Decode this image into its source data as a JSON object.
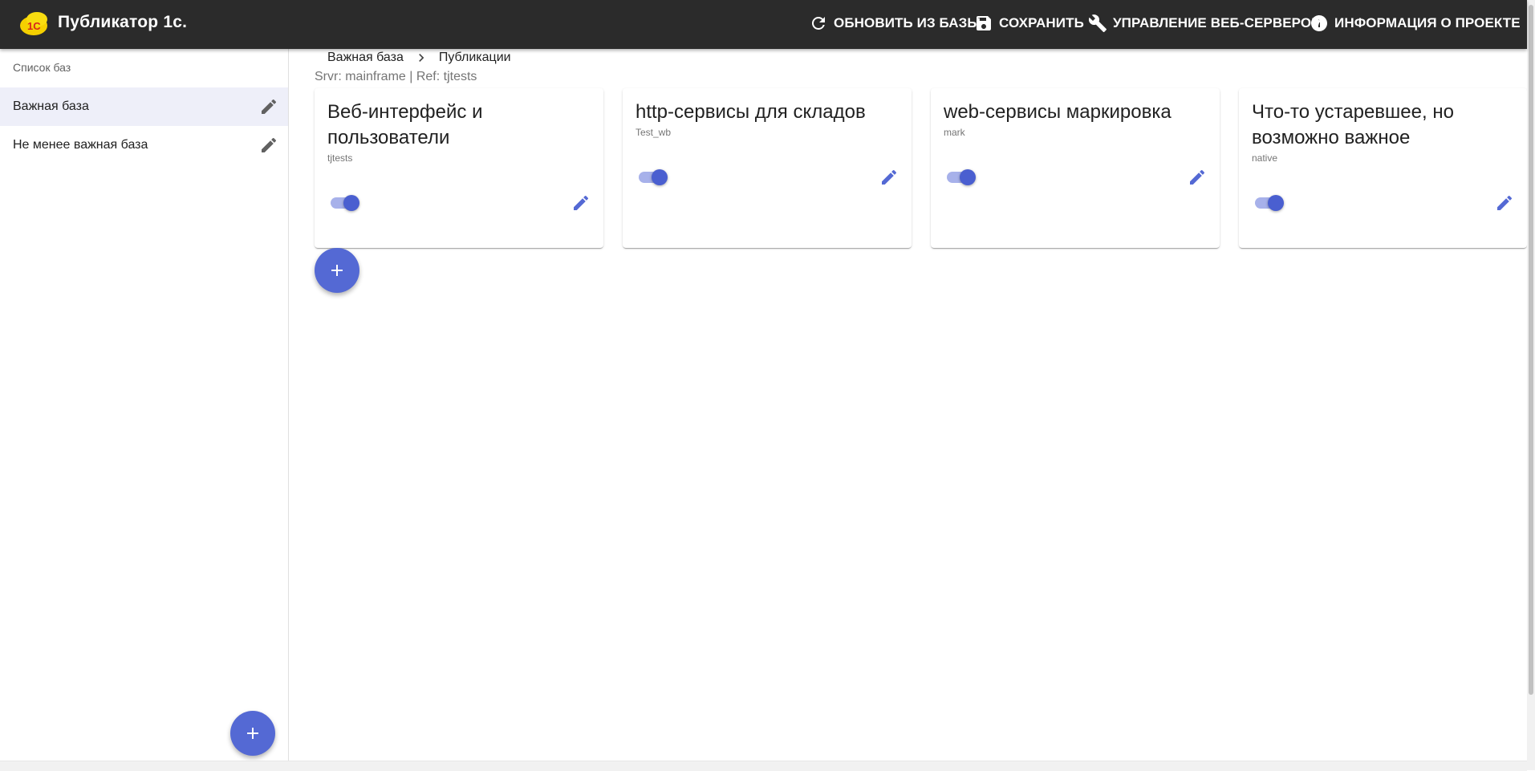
{
  "app": {
    "title": "Публикатор 1с.",
    "logo_text": "1С"
  },
  "toolbar": {
    "refresh_label": "ОБНОВИТЬ ИЗ БАЗЫ",
    "save_label": "СОХРАНИТЬ",
    "webserver_label": "УПРАВЛЕНИЕ ВЕБ-СЕРВЕРОМ",
    "info_label": "ИНФОРМАЦИЯ О ПРОЕКТЕ"
  },
  "sidebar": {
    "header": "Список баз",
    "items": [
      {
        "label": "Важная база",
        "active": true
      },
      {
        "label": "Не менее важная база",
        "active": false
      }
    ]
  },
  "breadcrumb": {
    "items": [
      "Важная база",
      "Публикации"
    ]
  },
  "server_info": "Srvr: mainframe | Ref: tjtests",
  "publications": [
    {
      "title": "Веб-интерфейс и пользователи",
      "name": "tjtests",
      "enabled": true
    },
    {
      "title": "http-сервисы для складов",
      "name": "Test_wb",
      "enabled": true
    },
    {
      "title": "web-сервисы маркировка",
      "name": "mark",
      "enabled": true
    },
    {
      "title": "Что-то устаревшее, но возможно важное",
      "name": "native",
      "enabled": true
    }
  ],
  "colors": {
    "appbar": "#2b2b2b",
    "accent": "#5469d4",
    "active_item_bg": "#eeeff9"
  }
}
